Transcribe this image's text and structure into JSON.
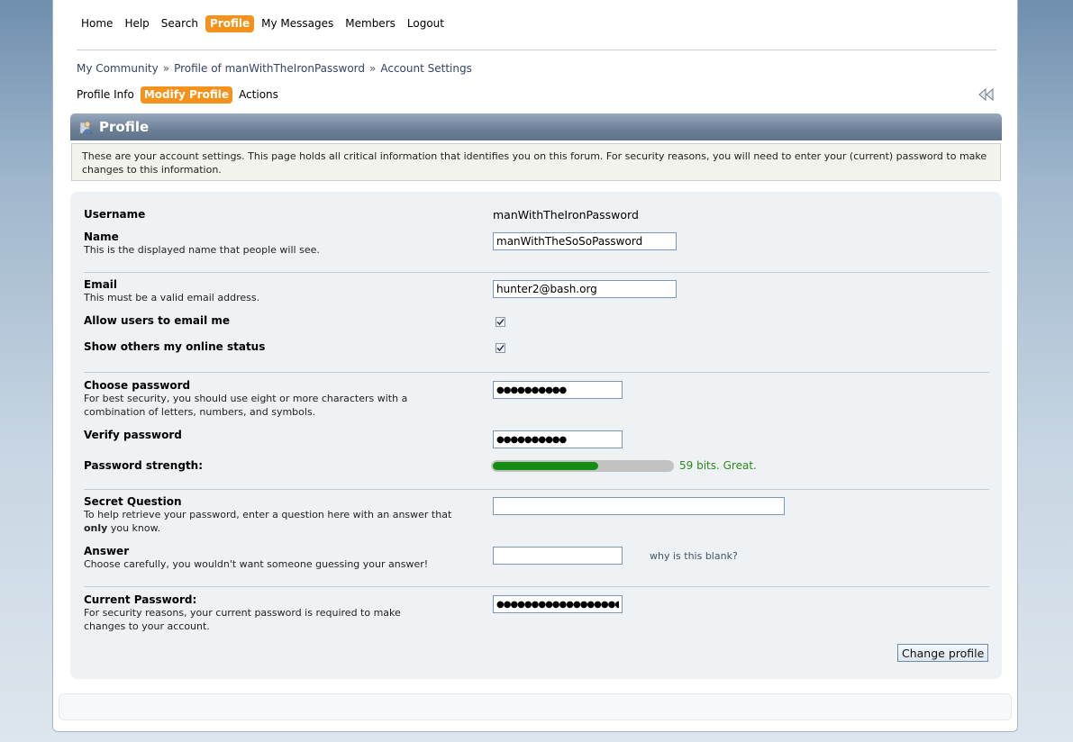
{
  "menu": {
    "items": [
      {
        "label": "Home",
        "active": false
      },
      {
        "label": "Help",
        "active": false
      },
      {
        "label": "Search",
        "active": false
      },
      {
        "label": "Profile",
        "active": true
      },
      {
        "label": "My Messages",
        "active": false
      },
      {
        "label": "Members",
        "active": false
      },
      {
        "label": "Logout",
        "active": false
      }
    ]
  },
  "breadcrumb": {
    "items": [
      "My Community",
      "Profile of manWithTheIronPassword",
      "Account Settings"
    ],
    "separator": "»"
  },
  "subtabs": {
    "items": [
      {
        "label": "Profile Info",
        "active": false
      },
      {
        "label": "Modify Profile",
        "active": true
      },
      {
        "label": "Actions",
        "active": false
      }
    ]
  },
  "header": {
    "title": "Profile",
    "icon": "user-profile-icon"
  },
  "intro": "These are your account settings. This page holds all critical information that identifies you on this forum. For security reasons, you will need to enter your (current) password to make changes to this information.",
  "form": {
    "username_label": "Username",
    "username_value": "manWithTheIronPassword",
    "name_label": "Name",
    "name_desc": "This is the displayed name that people will see.",
    "name_value": "manWithTheSoSoPassword",
    "email_label": "Email",
    "email_desc": "This must be a valid email address.",
    "email_value": "hunter2@bash.org",
    "allow_email_label": "Allow users to email me",
    "allow_email_checked": true,
    "show_online_label": "Show others my online status",
    "show_online_checked": true,
    "choose_password_label": "Choose password",
    "choose_password_desc": "For best security, you should use eight or more characters with a combination of letters, numbers, and symbols.",
    "choose_password_value": "●●●●●●●●●●",
    "verify_password_label": "Verify password",
    "verify_password_value": "●●●●●●●●●●",
    "strength_label": "Password strength:",
    "strength_fraction": 0.59,
    "strength_text": "59 bits. Great.",
    "strength_color": "#138d12",
    "secret_question_label": "Secret Question",
    "secret_question_desc_1": "To help retrieve your password, enter a question here with an answer that ",
    "secret_question_desc_bold": "only",
    "secret_question_desc_2": " you know.",
    "secret_question_value": "",
    "answer_label": "Answer",
    "answer_desc": "Choose carefully, you wouldn't want someone guessing your answer!",
    "answer_value": "",
    "answer_hint": "why is this blank?",
    "current_password_label": "Current Password:",
    "current_password_desc": "For security reasons, your current password is required to make changes to your account.",
    "current_password_value": "●●●●●●●●●●●●●●●●●●",
    "submit_label": "Change profile"
  },
  "colors": {
    "accent": "#f5921b",
    "header_bar": "#6b7f96",
    "panel_bg": "#eef2f5"
  }
}
